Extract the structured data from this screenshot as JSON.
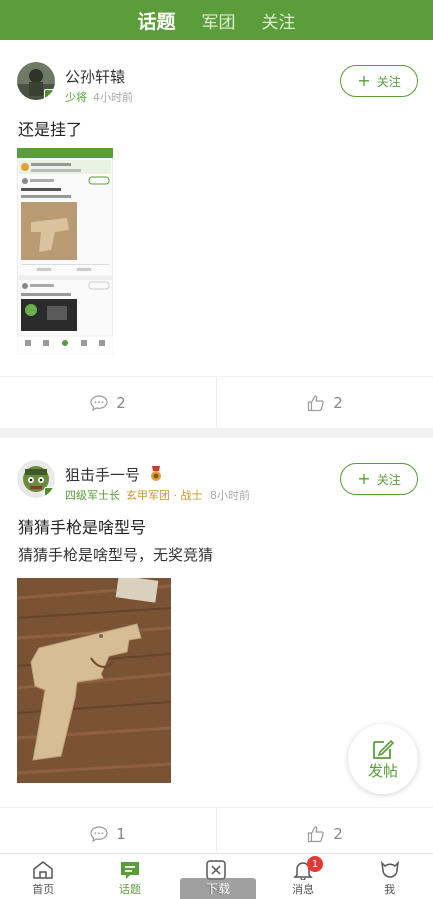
{
  "topbar": {
    "tabs": [
      {
        "label": "话题",
        "active": true
      },
      {
        "label": "军团",
        "active": false
      },
      {
        "label": "关注",
        "active": false
      }
    ]
  },
  "posts": [
    {
      "username": "公孙轩辕",
      "rank": "少将",
      "time": "4小时前",
      "follow_label": "关注",
      "title": "还是挂了",
      "comments": "2",
      "likes": "2"
    },
    {
      "username": "狙击手一号",
      "rank": "四级军士长",
      "army": "玄甲军团 · 战士",
      "time": "8小时前",
      "follow_label": "关注",
      "title": "猜猜手枪是啥型号",
      "body": "猜猜手枪是啥型号，无奖竞猜",
      "comments": "1",
      "likes": "2"
    }
  ],
  "fab": {
    "label": "发帖"
  },
  "bottomnav": {
    "items": [
      {
        "label": "首页"
      },
      {
        "label": "话题"
      },
      {
        "label": "下载"
      },
      {
        "label": "消息",
        "badge": "1"
      },
      {
        "label": "我"
      }
    ]
  },
  "toast": "下载",
  "colors": {
    "brand": "#5b9c3b",
    "badge": "#e53935",
    "army": "#c89a2a"
  }
}
